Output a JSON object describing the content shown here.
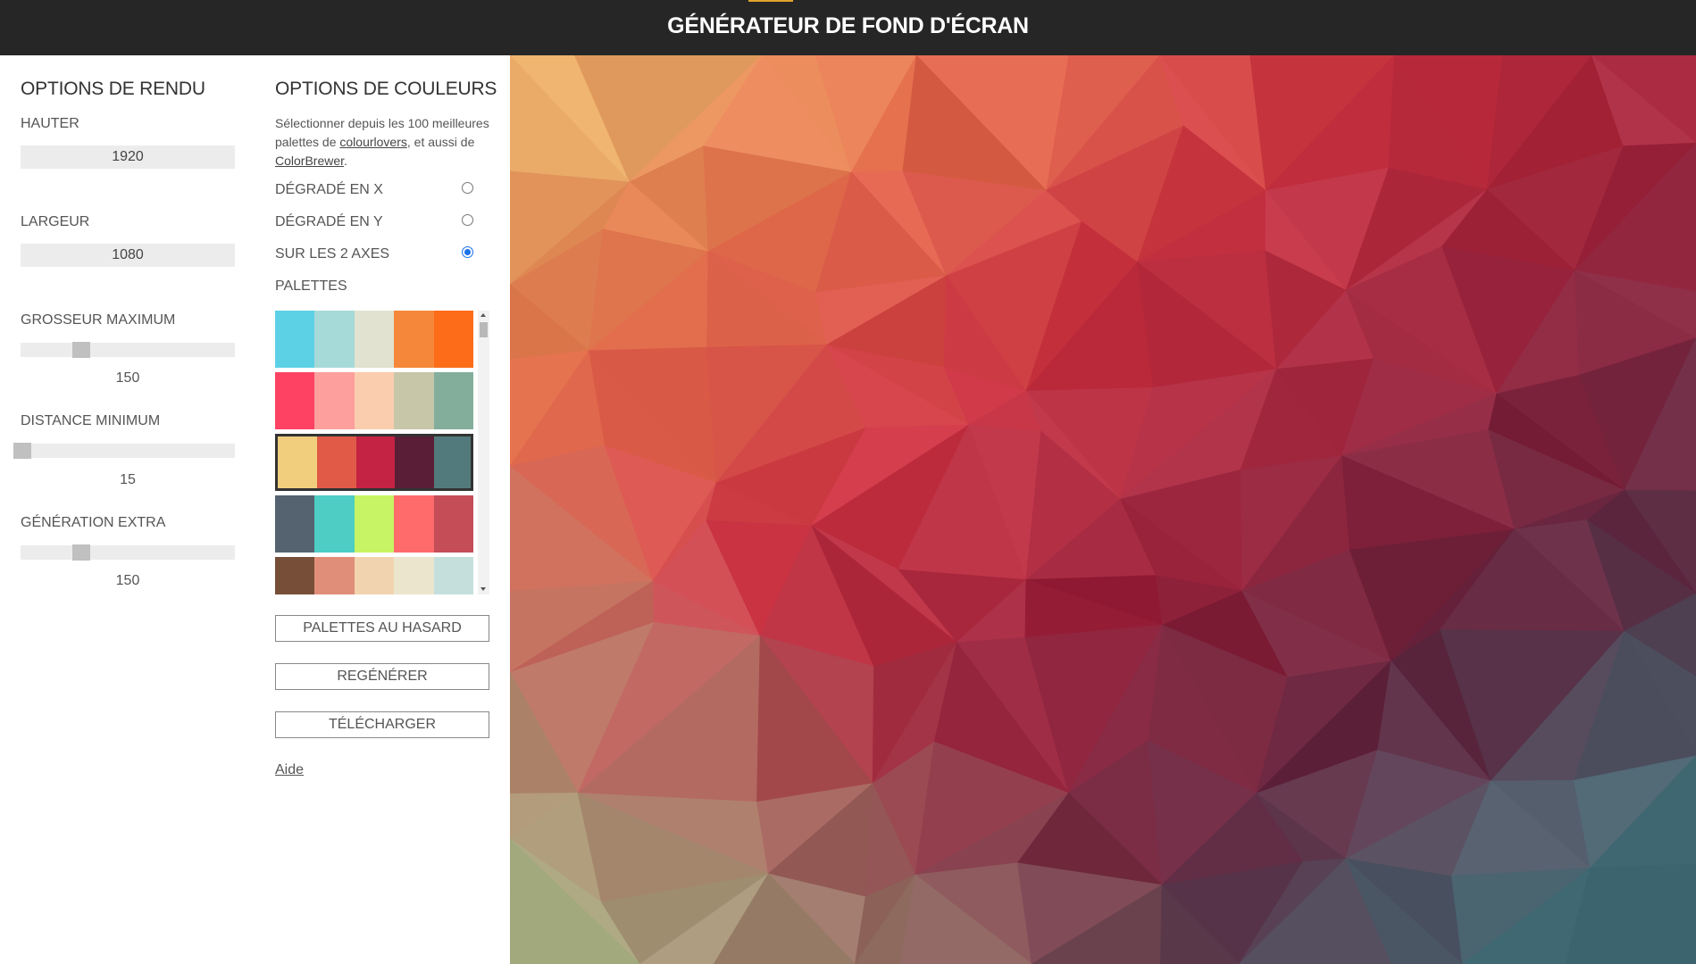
{
  "header": {
    "title": "GÉNÉRATEUR DE FOND D'ÉCRAN",
    "accent_color": "#e0a32b"
  },
  "render_options": {
    "title": "OPTIONS DE RENDU",
    "height_label": "HAUTER",
    "height_value": "1920",
    "width_label": "LARGEUR",
    "width_value": "1080",
    "max_size_label": "GROSSEUR MAXIMUM",
    "max_size_value": "150",
    "min_distance_label": "DISTANCE MINIMUM",
    "min_distance_value": "15",
    "extra_label": "GÉNÉRATION EXTRA",
    "extra_value": "150"
  },
  "color_options": {
    "title": "OPTIONS DE COULEURS",
    "desc_part1": "Sélectionner depuis les 100 meilleures palettes de ",
    "desc_link1": "colourlovers",
    "desc_part2": ", et aussi de ",
    "desc_link2": "ColorBrewer",
    "desc_part3": ".",
    "radio_x": "DÉGRADÉ EN X",
    "radio_y": "DÉGRADÉ EN Y",
    "radio_both": "SUR LES 2 AXES",
    "selected_mode": "SUR LES 2 AXES",
    "palettes_label": "PALETTES",
    "palettes": [
      [
        "#5cd1e5",
        "#a6dad8",
        "#e1e2d0",
        "#f5873a",
        "#fd6c19"
      ],
      [
        "#fd4263",
        "#fd9f9c",
        "#facdae",
        "#c8c6a8",
        "#83ae9b"
      ],
      [
        "#f0ce7e",
        "#e05a47",
        "#c42343",
        "#5a1e37",
        "#527a7c"
      ],
      [
        "#556270",
        "#4ecdc4",
        "#c7f464",
        "#ff6b6b",
        "#c44d58"
      ],
      [
        "#774f38",
        "#e08e79",
        "#f1d4af",
        "#ece5ce",
        "#c5e0dc"
      ]
    ],
    "selected_palette": 2,
    "random_button": "PALETTES AU HASARD",
    "regenerate_button": "REGÉNÉRER",
    "download_button": "TÉLÉCHARGER",
    "help_link": "Aide"
  }
}
